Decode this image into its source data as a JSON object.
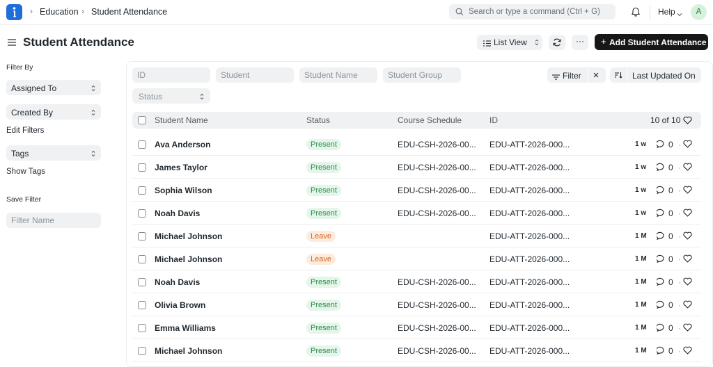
{
  "navbar": {
    "breadcrumbs": [
      "Education",
      "Student Attendance"
    ],
    "search_placeholder": "Search or type a command (Ctrl + G)",
    "help_label": "Help",
    "avatar_initial": "A"
  },
  "page": {
    "title": "Student Attendance",
    "list_view_label": "List View",
    "more_label": "···",
    "add_button_label": "Add Student Attendance"
  },
  "sidebar": {
    "filter_by_label": "Filter By",
    "assigned_to_label": "Assigned To",
    "created_by_label": "Created By",
    "edit_filters_label": "Edit Filters",
    "tags_label": "Tags",
    "show_tags_label": "Show Tags",
    "save_filter_label": "Save Filter",
    "filter_name_placeholder": "Filter Name"
  },
  "filters": {
    "id_placeholder": "ID",
    "student_placeholder": "Student",
    "student_name_placeholder": "Student Name",
    "student_group_placeholder": "Student Group",
    "status_placeholder": "Status",
    "filter_label": "Filter",
    "sort_label": "Last Updated On"
  },
  "table": {
    "columns": {
      "name": "Student Name",
      "status": "Status",
      "schedule": "Course Schedule",
      "id": "ID"
    },
    "count_label": "10 of 10",
    "rows": [
      {
        "name": "Ava Anderson",
        "status": "Present",
        "schedule": "EDU-CSH-2026-00...",
        "id": "EDU-ATT-2026-000...",
        "age": "1 w",
        "comments": "0"
      },
      {
        "name": "James Taylor",
        "status": "Present",
        "schedule": "EDU-CSH-2026-00...",
        "id": "EDU-ATT-2026-000...",
        "age": "1 w",
        "comments": "0"
      },
      {
        "name": "Sophia Wilson",
        "status": "Present",
        "schedule": "EDU-CSH-2026-00...",
        "id": "EDU-ATT-2026-000...",
        "age": "1 w",
        "comments": "0"
      },
      {
        "name": "Noah Davis",
        "status": "Present",
        "schedule": "EDU-CSH-2026-00...",
        "id": "EDU-ATT-2026-000...",
        "age": "1 w",
        "comments": "0"
      },
      {
        "name": "Michael Johnson",
        "status": "Leave",
        "schedule": "",
        "id": "EDU-ATT-2026-000...",
        "age": "1 M",
        "comments": "0"
      },
      {
        "name": "Michael Johnson",
        "status": "Leave",
        "schedule": "",
        "id": "EDU-ATT-2026-000...",
        "age": "1 M",
        "comments": "0"
      },
      {
        "name": "Noah Davis",
        "status": "Present",
        "schedule": "EDU-CSH-2026-00...",
        "id": "EDU-ATT-2026-000...",
        "age": "1 M",
        "comments": "0"
      },
      {
        "name": "Olivia Brown",
        "status": "Present",
        "schedule": "EDU-CSH-2026-00...",
        "id": "EDU-ATT-2026-000...",
        "age": "1 M",
        "comments": "0"
      },
      {
        "name": "Emma Williams",
        "status": "Present",
        "schedule": "EDU-CSH-2026-00...",
        "id": "EDU-ATT-2026-000...",
        "age": "1 M",
        "comments": "0"
      },
      {
        "name": "Michael Johnson",
        "status": "Present",
        "schedule": "EDU-CSH-2026-00...",
        "id": "EDU-ATT-2026-000...",
        "age": "1 M",
        "comments": "0"
      }
    ]
  },
  "colors": {
    "brand": "#1e6fd9",
    "present_bg": "#e4f5e9",
    "present_fg": "#2e8a4f",
    "leave_bg": "#fdecde",
    "leave_fg": "#d9651f",
    "primary_button": "#171717"
  }
}
